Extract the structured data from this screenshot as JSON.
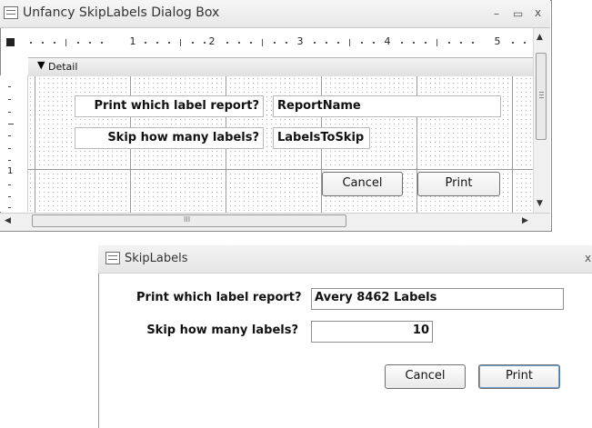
{
  "design_window": {
    "title": "Unfancy SkipLabels Dialog Box",
    "minimize_glyph": "–",
    "restore_glyph": "▭",
    "close_glyph": "x",
    "ruler_numbers": [
      "1",
      "2",
      "3",
      "4",
      "5"
    ],
    "left_ruler_numbers": [
      "1"
    ],
    "section_label": "Detail",
    "section_icon": "arrow-down-icon",
    "label_report": "Print which label report?",
    "field_report": "ReportName",
    "label_skip": "Skip how many labels?",
    "field_skip": "LabelsToSkip",
    "cancel_label": "Cancel",
    "print_label": "Print",
    "scroll_up": "▲",
    "scroll_down": "▼",
    "scroll_left": "◀",
    "scroll_right": "▶",
    "hscroll_grip": "III"
  },
  "run_dialog": {
    "title": "SkipLabels",
    "close_glyph": "x",
    "label_report": "Print which label report?",
    "value_report": "Avery 8462 Labels",
    "label_skip": "Skip how many labels?",
    "value_skip": "10",
    "cancel_label": "Cancel",
    "print_label": "Print"
  }
}
